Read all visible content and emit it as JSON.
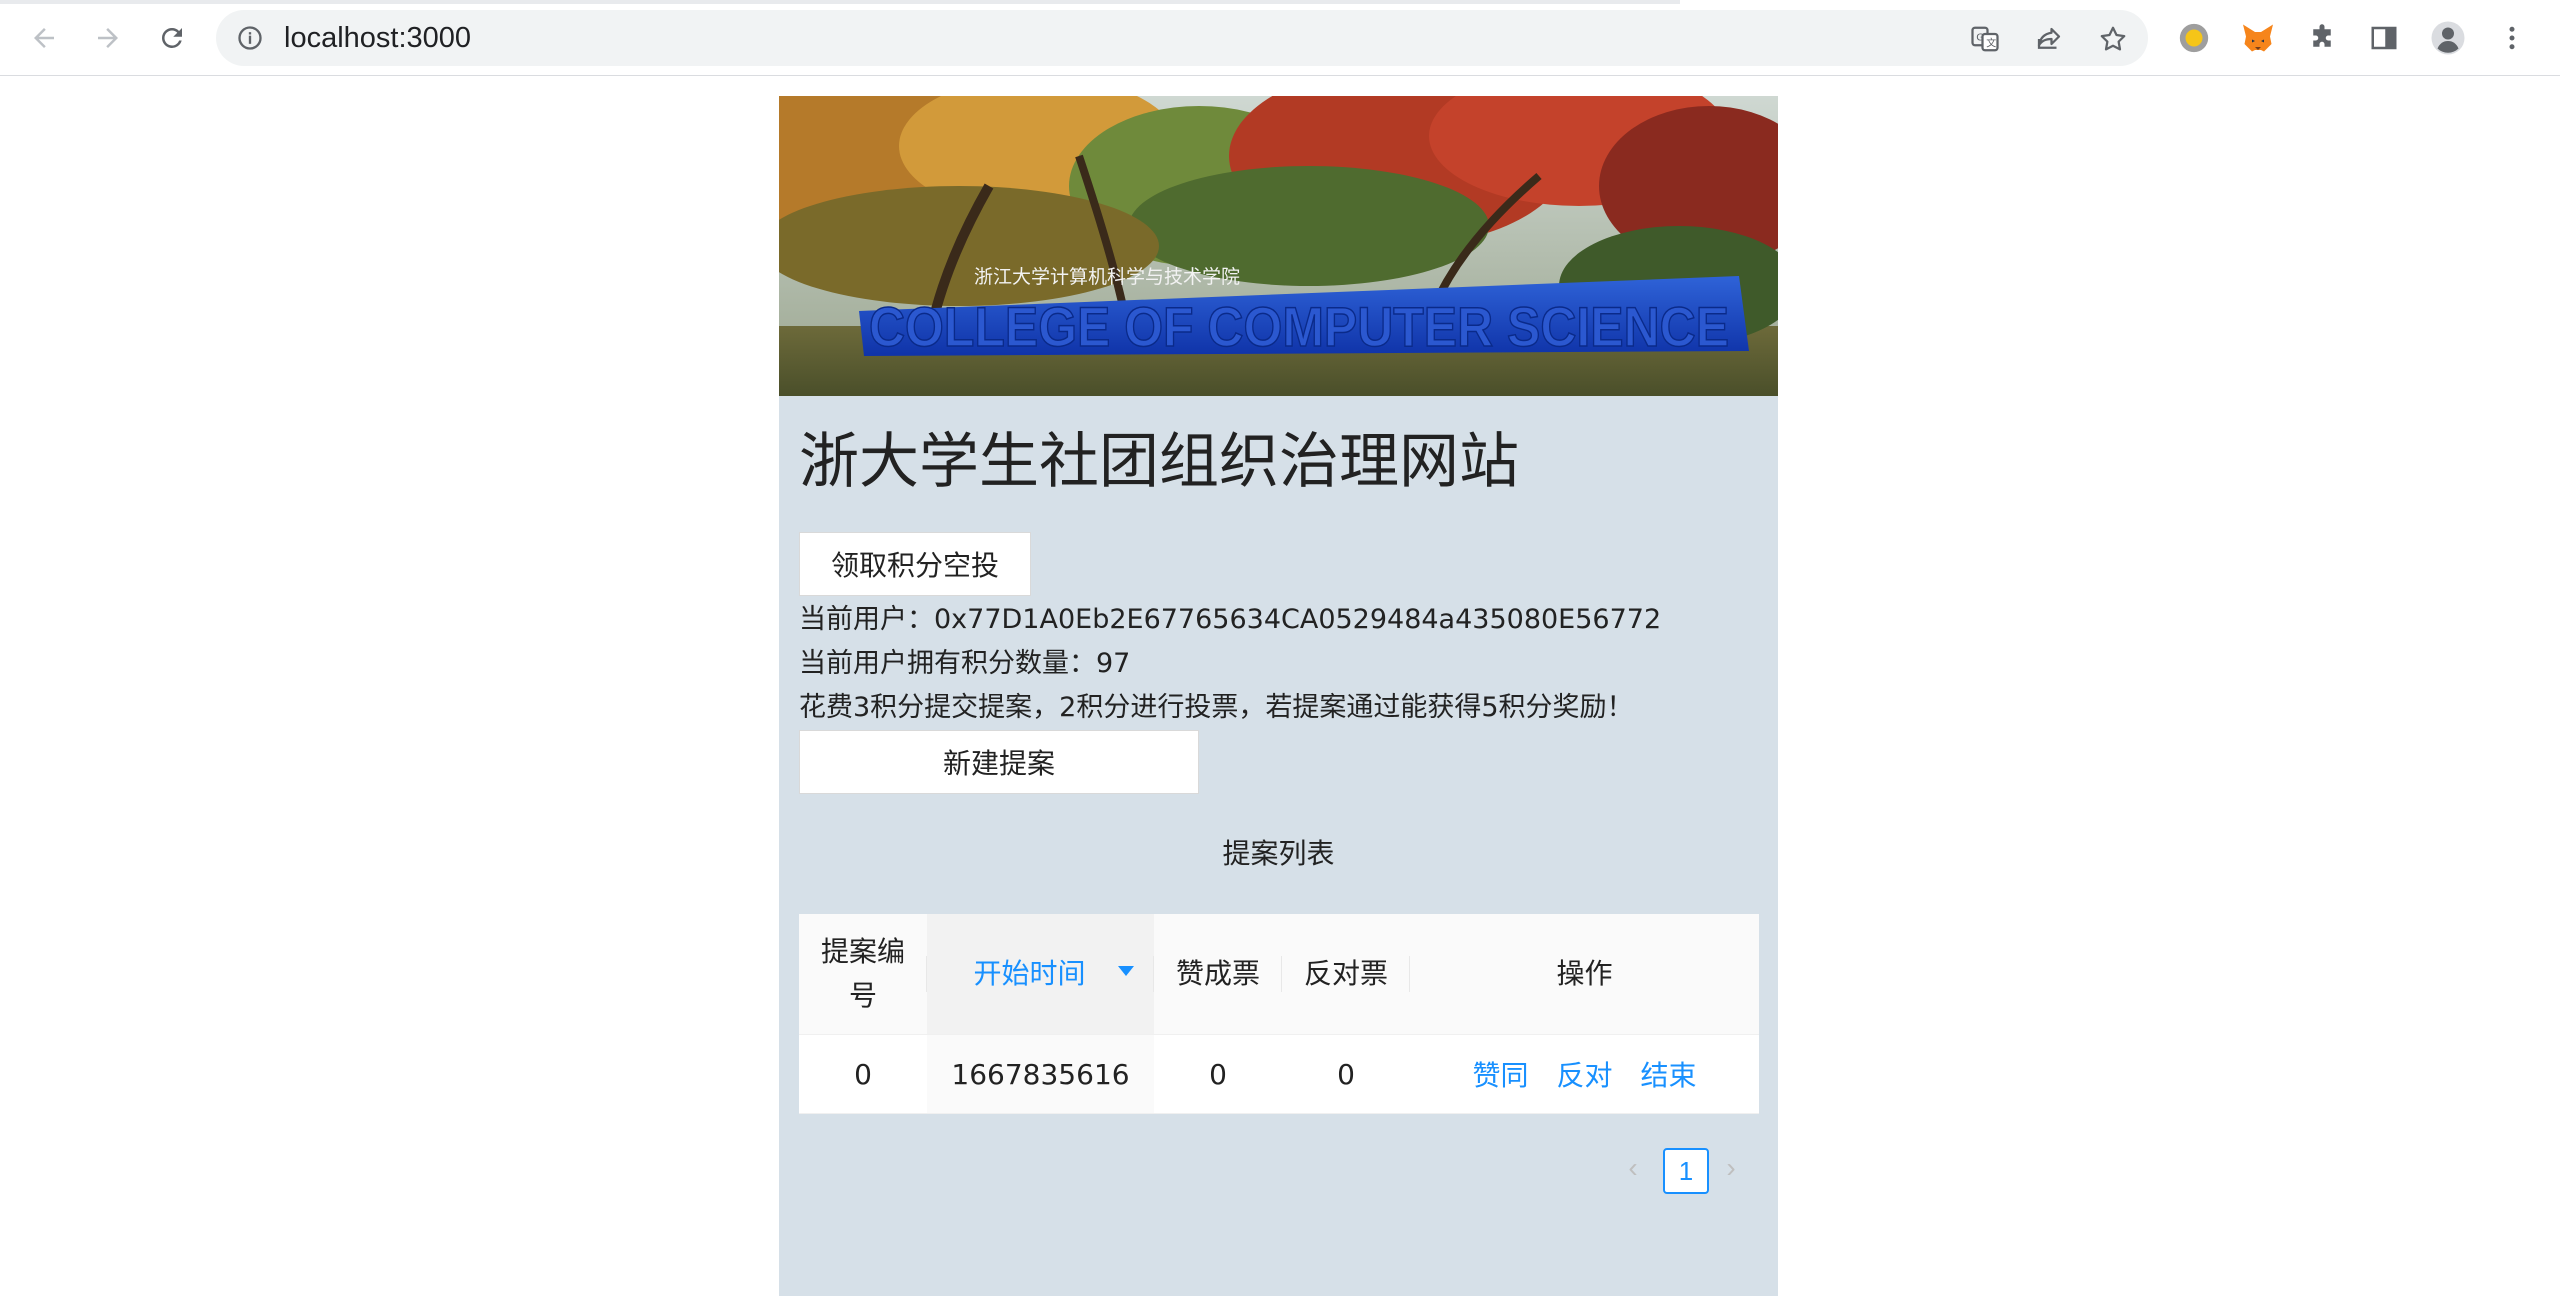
{
  "browser": {
    "url": "localhost:3000",
    "icons": {
      "back": "back-arrow-icon",
      "forward": "forward-arrow-icon",
      "reload": "reload-icon",
      "info": "info-icon",
      "translate": "translate-icon",
      "share": "share-icon",
      "bookmark": "star-icon",
      "extension_1": "yellow-circle-extension-icon",
      "metamask": "fox-icon",
      "extensions": "puzzle-icon",
      "side_panel": "side-panel-icon",
      "profile": "profile-icon",
      "menu": "kebab-menu-icon"
    }
  },
  "page": {
    "banner_sign_cn": "浙江大学计算机科学与技术学院",
    "banner_sign_en": "COLLEGE OF COMPUTER SCIENCE",
    "title": "浙大学生社团组织治理网站",
    "airdrop_button": "领取积分空投",
    "current_user": "当前用户：0x77D1A0Eb2E67765634CA0529484a435080E56772",
    "current_points": "当前用户拥有积分数量：97",
    "rules": "花费3积分提交提案，2积分进行投票，若提案通过能获得5积分奖励！",
    "new_proposal_button": "新建提案",
    "table_caption": "提案列表"
  },
  "table": {
    "columns": [
      "提案编号",
      "开始时间",
      "赞成票",
      "反对票",
      "操作"
    ],
    "rows": [
      {
        "id": "0",
        "start": "1667835616",
        "yes": "0",
        "no": "0",
        "actions": [
          "赞同",
          "反对",
          "结束"
        ]
      }
    ]
  },
  "pagination": {
    "prev": "‹",
    "current": "1",
    "next": "›"
  },
  "colors": {
    "accent": "#1890ff",
    "panel_bg": "#d6e0e8"
  }
}
